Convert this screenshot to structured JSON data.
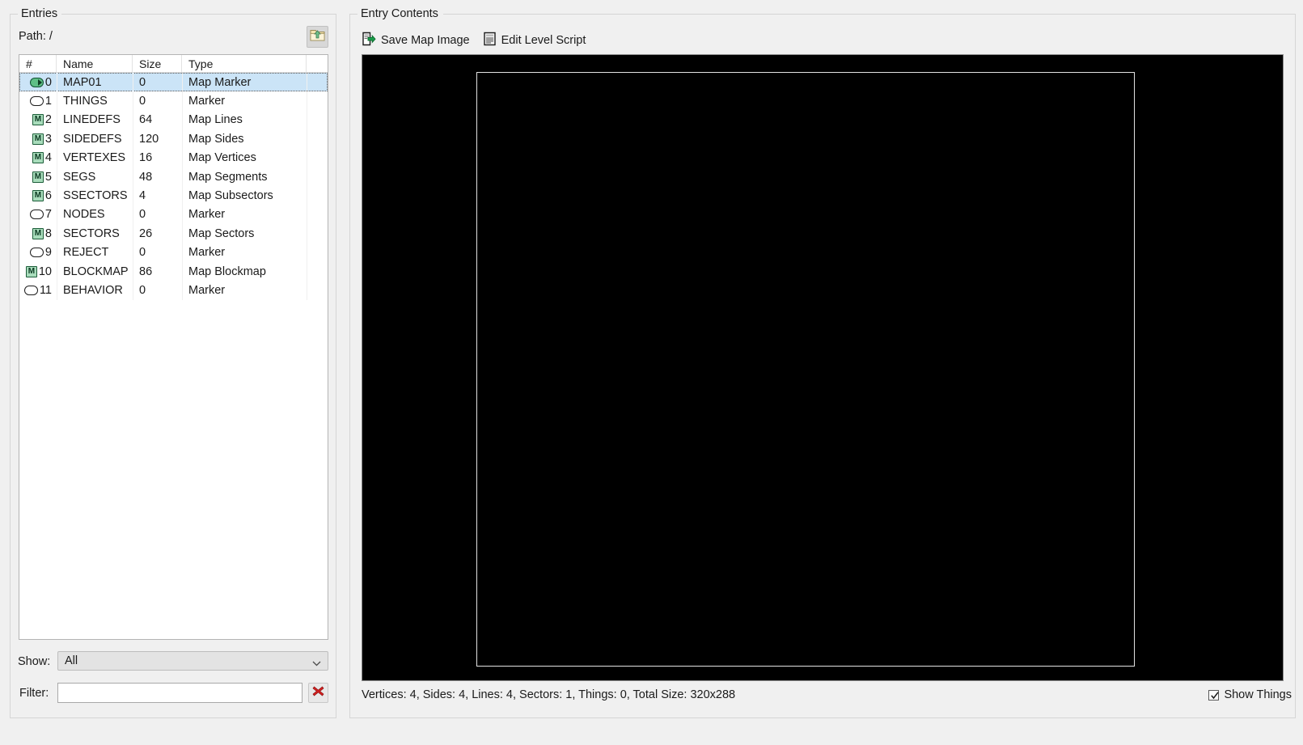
{
  "entries_panel": {
    "title": "Entries",
    "path_label": "Path: /",
    "updir_icon": "folder-up-icon",
    "columns": [
      "#",
      "Name",
      "Size",
      "Type"
    ],
    "rows": [
      {
        "icon": "map-marker-icon",
        "num": "0",
        "name": "MAP01",
        "size": "0",
        "type": "Map Marker",
        "selected": true
      },
      {
        "icon": "marker-icon",
        "num": "1",
        "name": "THINGS",
        "size": "0",
        "type": "Marker",
        "selected": false
      },
      {
        "icon": "map-entry-icon",
        "num": "2",
        "name": "LINEDEFS",
        "size": "64",
        "type": "Map Lines",
        "selected": false
      },
      {
        "icon": "map-entry-icon",
        "num": "3",
        "name": "SIDEDEFS",
        "size": "120",
        "type": "Map Sides",
        "selected": false
      },
      {
        "icon": "map-entry-icon",
        "num": "4",
        "name": "VERTEXES",
        "size": "16",
        "type": "Map Vertices",
        "selected": false
      },
      {
        "icon": "map-entry-icon",
        "num": "5",
        "name": "SEGS",
        "size": "48",
        "type": "Map Segments",
        "selected": false
      },
      {
        "icon": "map-entry-icon",
        "num": "6",
        "name": "SSECTORS",
        "size": "4",
        "type": "Map Subsectors",
        "selected": false
      },
      {
        "icon": "marker-icon",
        "num": "7",
        "name": "NODES",
        "size": "0",
        "type": "Marker",
        "selected": false
      },
      {
        "icon": "map-entry-icon",
        "num": "8",
        "name": "SECTORS",
        "size": "26",
        "type": "Map Sectors",
        "selected": false
      },
      {
        "icon": "marker-icon",
        "num": "9",
        "name": "REJECT",
        "size": "0",
        "type": "Marker",
        "selected": false
      },
      {
        "icon": "map-entry-icon",
        "num": "10",
        "name": "BLOCKMAP",
        "size": "86",
        "type": "Map Blockmap",
        "selected": false
      },
      {
        "icon": "marker-icon",
        "num": "11",
        "name": "BEHAVIOR",
        "size": "0",
        "type": "Marker",
        "selected": false
      }
    ],
    "show": {
      "label": "Show:",
      "value": "All"
    },
    "filter": {
      "label": "Filter:",
      "value": "",
      "placeholder": ""
    },
    "clear_icon": "red-x-icon"
  },
  "contents_panel": {
    "title": "Entry Contents",
    "toolbar": {
      "save_map_image": "Save Map Image",
      "save_map_image_icon": "export-document-icon",
      "edit_level_script": "Edit Level Script",
      "edit_level_script_icon": "script-document-icon"
    },
    "map_preview": {
      "background_color": "#000000",
      "outline_color": "#e2e2e2"
    },
    "status": "Vertices: 4, Sides: 4, Lines: 4, Sectors: 1, Things: 0, Total Size: 320x288",
    "show_things": {
      "label": "Show Things",
      "checked": true
    }
  },
  "colors": {
    "window_background": "#f0f0f0",
    "selection": "#cbe4f7",
    "list_background": "#ffffff",
    "map_background": "#000000"
  }
}
